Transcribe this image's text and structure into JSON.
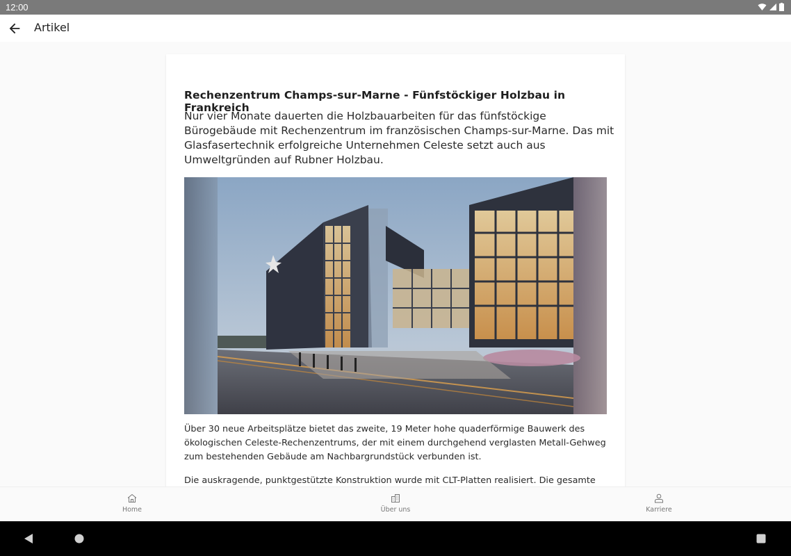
{
  "status_bar": {
    "time": "12:00",
    "wifi_icon": "wifi-icon",
    "signal_icon": "signal-icon",
    "battery_icon": "battery-icon"
  },
  "app_bar": {
    "back_icon": "arrow-back-icon",
    "title": "Artikel"
  },
  "article": {
    "title": "Rechenzentrum Champs-sur-Marne - Fünfstöckiger Holzbau in Frankreich",
    "lead": "Nur vier Monate dauerten die Holzbauarbeiten für das fünfstöckige Bürogebäude mit Rechenzentrum im französischen Champs-sur-Marne. Das mit Glasfasertechnik erfolgreiche Unternehmen Celeste setzt auch aus Umweltgründen auf Rubner Holzbau.",
    "paragraph1": "Über 30 neue Arbeitsplätze bietet das zweite, 19 Meter hohe quaderförmige Bauwerk des ökologischen Celeste-Rechenzentrums,  der mit einem durchgehend verglasten Metall-Gehweg zum bestehenden Gebäude am Nachbargrundstück verbunden ist.",
    "paragraph2": "Die auskragende, punktgestützte Konstruktion wurde mit CLT-Platten realisiert. Die gesamte"
  },
  "bottom_nav": {
    "items": [
      {
        "label": "Home",
        "icon": "home-icon"
      },
      {
        "label": "Über uns",
        "icon": "building-icon"
      },
      {
        "label": "Karriere",
        "icon": "person-icon"
      }
    ]
  },
  "system_nav": {
    "back": "back-triangle-icon",
    "home": "home-circle-icon",
    "recents": "recents-square-icon"
  }
}
